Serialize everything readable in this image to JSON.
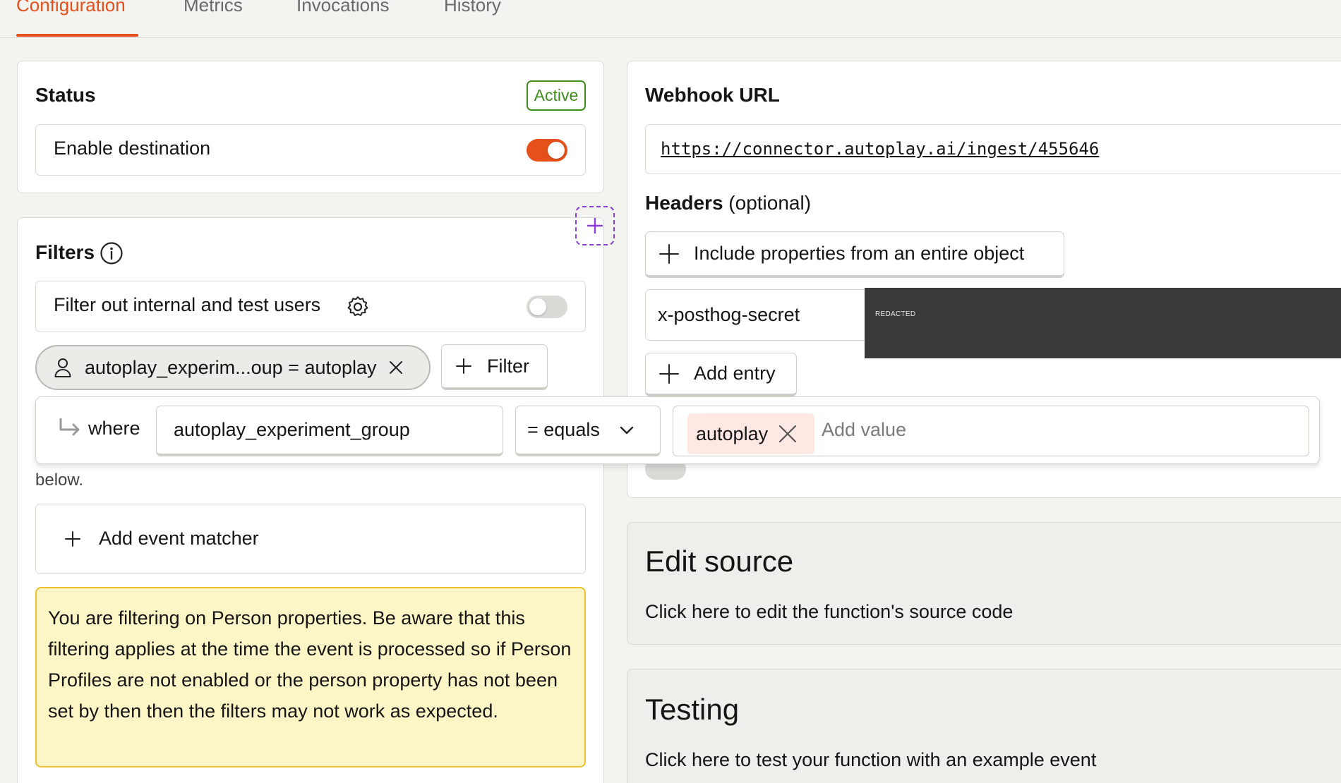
{
  "tabs": [
    {
      "label": "Configuration",
      "active": true
    },
    {
      "label": "Metrics",
      "active": false
    },
    {
      "label": "Invocations",
      "active": false
    },
    {
      "label": "History",
      "active": false
    }
  ],
  "status": {
    "title": "Status",
    "badge": "Active",
    "enable_label": "Enable destination",
    "enabled": true
  },
  "filters": {
    "title": "Filters",
    "internal_label": "Filter out internal and test users",
    "internal_enabled": false,
    "chip_label": "autoplay_experim...oup = autoplay",
    "filter_button": "Filter",
    "popover": {
      "where": "where",
      "property": "autoplay_experiment_group",
      "operator": "= equals",
      "value": "autoplay",
      "value_placeholder": "Add value"
    },
    "note_tail": "below.",
    "add_matcher": "Add event matcher",
    "warning": "You are filtering on Person properties. Be aware that this filtering applies at the time the event is processed so if Person Profiles are not enabled or the person property has not been set by then then the filters may not work as expected."
  },
  "webhook": {
    "title": "Webhook URL",
    "url": "https://connector.autoplay.ai/ingest/455646",
    "headers_title": "Headers",
    "headers_optional": "(optional)",
    "include_button": "Include properties from an entire object",
    "header_key": "x-posthog-secret",
    "redacted": "REDACTED",
    "add_entry": "Add entry"
  },
  "edit_source": {
    "title": "Edit source",
    "desc": "Click here to edit the function's source code"
  },
  "testing": {
    "title": "Testing",
    "desc": "Click here to test your function with an example event"
  },
  "colors": {
    "accent": "#e6501b",
    "active_green": "#3f8b1c",
    "warning_bg": "#fcf6c6",
    "warning_border": "#f0c231",
    "purple": "#8b3fd9"
  }
}
